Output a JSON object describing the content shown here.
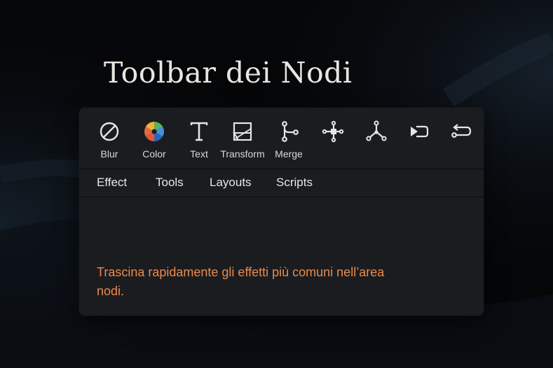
{
  "title": "Toolbar dei Nodi",
  "toolbar": {
    "items": [
      {
        "label": "Blur",
        "icon": "blur-icon"
      },
      {
        "label": "Color",
        "icon": "color-wheel-icon"
      },
      {
        "label": "Text",
        "icon": "text-icon"
      },
      {
        "label": "Transform",
        "icon": "transform-icon"
      },
      {
        "label": "Merge",
        "icon": "merge-icon"
      },
      {
        "label": "",
        "icon": "node-connect-icon"
      },
      {
        "label": "",
        "icon": "split-node-icon"
      },
      {
        "label": "",
        "icon": "output-node-icon"
      },
      {
        "label": "",
        "icon": "return-node-icon"
      }
    ]
  },
  "tabs": [
    "Effect",
    "Tools",
    "Layouts",
    "Scripts"
  ],
  "hint": "Trascina rapidamente gli effetti più comuni nell’area nodi.",
  "colors": {
    "background": "#050608",
    "panel": "#1b1c1f",
    "hint_text": "#e98a4c",
    "color_wheel": [
      "#e0573a",
      "#f2b23b",
      "#5bb15f",
      "#4a90d9",
      "#2d66b8",
      "#e8e8e8"
    ]
  }
}
